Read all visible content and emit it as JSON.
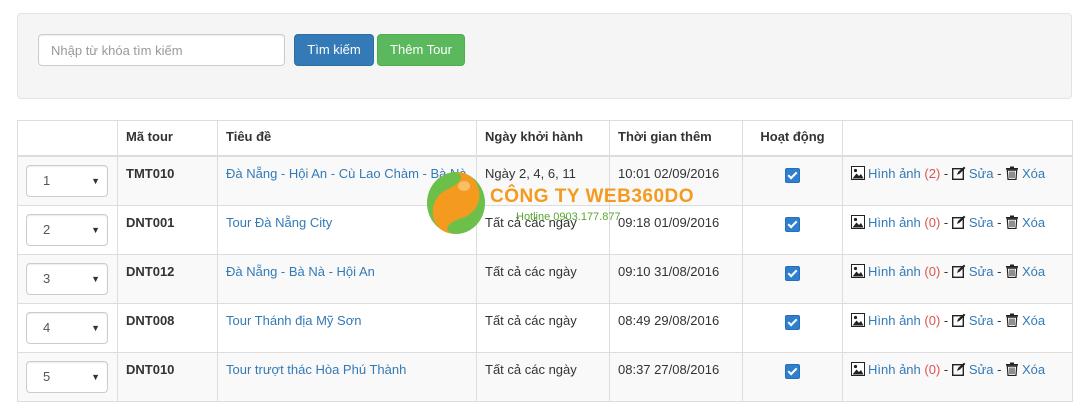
{
  "search": {
    "placeholder": "Nhập từ khóa tìm kiếm",
    "search_button": "Tìm kiếm",
    "add_button": "Thêm Tour"
  },
  "table": {
    "headers": [
      "",
      "Mã tour",
      "Tiêu đề",
      "Ngày khởi hành",
      "Thời gian thêm",
      "Hoạt động",
      ""
    ],
    "rows": [
      {
        "order": "1",
        "code": "TMT010",
        "title": "Đà Nẵng - Hội An - Cù Lao Chàm - Bà Nà",
        "departure": "Ngày 2, 4, 6, 11",
        "added": "10:01 02/09/2016",
        "active": true,
        "image_label": "Hình ảnh",
        "image_count": "(2)",
        "edit_label": "Sửa",
        "delete_label": "Xóa"
      },
      {
        "order": "2",
        "code": "DNT001",
        "title": "Tour Đà Nẵng City",
        "departure": "Tất cả các ngày",
        "added": "09:18 01/09/2016",
        "active": true,
        "image_label": "Hình ảnh",
        "image_count": "(0)",
        "edit_label": "Sửa",
        "delete_label": "Xóa"
      },
      {
        "order": "3",
        "code": "DNT012",
        "title": "Đà Nẵng - Bà Nà - Hội An",
        "departure": "Tất cả các ngày",
        "added": "09:10 31/08/2016",
        "active": true,
        "image_label": "Hình ảnh",
        "image_count": "(0)",
        "edit_label": "Sửa",
        "delete_label": "Xóa"
      },
      {
        "order": "4",
        "code": "DNT008",
        "title": "Tour Thánh địa Mỹ Sơn",
        "departure": "Tất cả các ngày",
        "added": "08:49 29/08/2016",
        "active": true,
        "image_label": "Hình ảnh",
        "image_count": "(0)",
        "edit_label": "Sửa",
        "delete_label": "Xóa"
      },
      {
        "order": "5",
        "code": "DNT010",
        "title": "Tour trượt thác Hòa Phú Thành",
        "departure": "Tất cả các ngày",
        "added": "08:37 27/08/2016",
        "active": true,
        "image_label": "Hình ảnh",
        "image_count": "(0)",
        "edit_label": "Sửa",
        "delete_label": "Xóa"
      }
    ]
  },
  "watermark": {
    "company": "CÔNG TY WEB360DO",
    "hotline": "Hotline 0903.177.877"
  },
  "icons": {
    "image": "image-icon",
    "edit": "edit-icon",
    "delete": "trash-icon",
    "dropdown": "caret-down-icon",
    "checkbox": "checkbox-checked-icon"
  },
  "colors": {
    "primary": "#337ab7",
    "success": "#5cb85c",
    "danger": "#d9534f",
    "watermark_orange": "#f39a1f",
    "watermark_green": "#55a630"
  }
}
